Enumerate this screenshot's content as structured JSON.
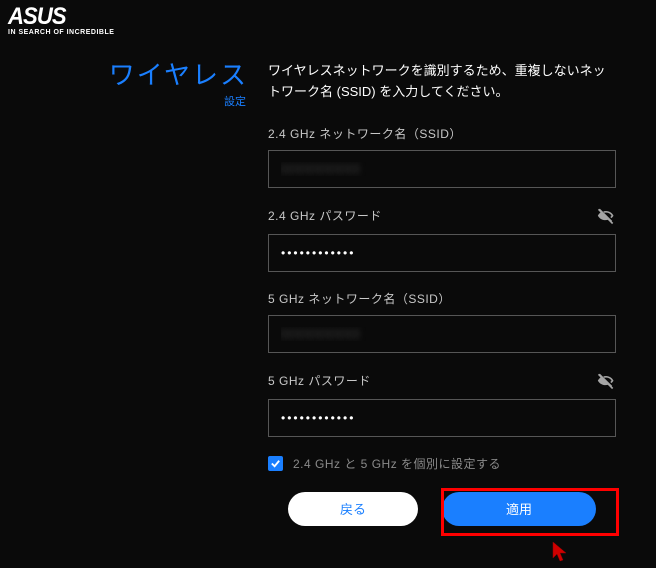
{
  "brand": {
    "name": "ASUS",
    "tagline": "IN SEARCH OF INCREDIBLE"
  },
  "side": {
    "title": "ワイヤレス",
    "subtitle": "設定"
  },
  "instructions": "ワイヤレスネットワークを識別するため、重複しないネットワーク名 (SSID) を入力してください。",
  "fields": {
    "ssid24": {
      "label": "2.4 GHz ネットワーク名（SSID）",
      "value": "XXXXXXXX"
    },
    "pw24": {
      "label": "2.4 GHz パスワード",
      "value": "••••••••••••"
    },
    "ssid5": {
      "label": "5 GHz ネットワーク名（SSID）",
      "value": "XXXXXXXX"
    },
    "pw5": {
      "label": "5 GHz パスワード",
      "value": "••••••••••••"
    }
  },
  "separate": {
    "checked": true,
    "label": "2.4 GHz と 5 GHz を個別に設定する"
  },
  "buttons": {
    "back": "戻る",
    "apply": "適用"
  }
}
